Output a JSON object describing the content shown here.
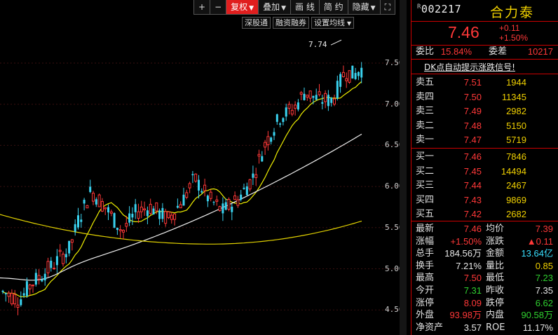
{
  "toolbar": {
    "plus": "+",
    "minus": "−",
    "fuquan": "复权",
    "diejia": "叠加",
    "huaxian": "画 线",
    "jianyue": "简 约",
    "yincang": "隐藏",
    "fullscreen": "⛶"
  },
  "subtoolbar": {
    "shengutong": "深股通",
    "rongzi": "融资融券",
    "junxian": "设置均线"
  },
  "chart": {
    "max_label": "7.74",
    "y_ticks": [
      "7.50",
      "7.00",
      "6.50",
      "6.00",
      "5.50",
      "5.00",
      "4.50"
    ],
    "up_color": "#ff3838",
    "down_color": "#3ad3f0",
    "ma_colors": [
      "#f0f000",
      "#f0f0f0",
      "#e0d000"
    ]
  },
  "chart_data": {
    "type": "candlestick",
    "y_ticks": [
      7.5,
      7.0,
      6.5,
      6.0,
      5.5,
      5.0,
      4.5
    ],
    "max_annotation": 7.74
  },
  "quote": {
    "code": "002217",
    "code_prefix": "R",
    "name": "合力泰",
    "price": "7.46",
    "change": "+0.11",
    "change_pct": "+1.50%",
    "weibi_label": "委比",
    "weibi": "15.84%",
    "weicha_label": "委差",
    "weicha": "10217",
    "alert": "DK点自动提示涨跌信号!"
  },
  "sell": [
    {
      "label": "卖五",
      "price": "7.51",
      "vol": "1944"
    },
    {
      "label": "卖四",
      "price": "7.50",
      "vol": "11345"
    },
    {
      "label": "卖三",
      "price": "7.49",
      "vol": "2982"
    },
    {
      "label": "卖二",
      "price": "7.48",
      "vol": "5150"
    },
    {
      "label": "卖一",
      "price": "7.47",
      "vol": "5719"
    }
  ],
  "buy": [
    {
      "label": "买一",
      "price": "7.46",
      "vol": "7846"
    },
    {
      "label": "买二",
      "price": "7.45",
      "vol": "14494"
    },
    {
      "label": "买三",
      "price": "7.44",
      "vol": "2467"
    },
    {
      "label": "买四",
      "price": "7.43",
      "vol": "9869"
    },
    {
      "label": "买五",
      "price": "7.42",
      "vol": "2682"
    }
  ],
  "stats": [
    {
      "l1": "最新",
      "v1": "7.46",
      "c1": "red",
      "l2": "均价",
      "v2": "7.39",
      "c2": "red"
    },
    {
      "l1": "涨幅",
      "v1": "+1.50%",
      "c1": "red",
      "l2": "涨跌",
      "v2": "▲0.11",
      "c2": "red"
    },
    {
      "l1": "总手",
      "v1": "184.56万",
      "c1": "white",
      "l2": "金额",
      "v2": "13.64亿",
      "c2": "cyan"
    },
    {
      "l1": "换手",
      "v1": "7.21%",
      "c1": "white",
      "l2": "量比",
      "v2": "0.85",
      "c2": "yellow"
    },
    {
      "l1": "最高",
      "v1": "7.50",
      "c1": "red",
      "l2": "最低",
      "v2": "7.23",
      "c2": "green"
    },
    {
      "l1": "今开",
      "v1": "7.31",
      "c1": "green",
      "l2": "昨收",
      "v2": "7.35",
      "c2": "white"
    },
    {
      "l1": "涨停",
      "v1": "8.09",
      "c1": "red",
      "l2": "跌停",
      "v2": "6.62",
      "c2": "green"
    },
    {
      "l1": "外盘",
      "v1": "93.98万",
      "c1": "red",
      "l2": "内盘",
      "v2": "90.58万",
      "c2": "green"
    },
    {
      "l1": "净资产",
      "v1": "3.57",
      "c1": "white",
      "l2": "ROE",
      "v2": "11.17%",
      "c2": "white"
    }
  ]
}
